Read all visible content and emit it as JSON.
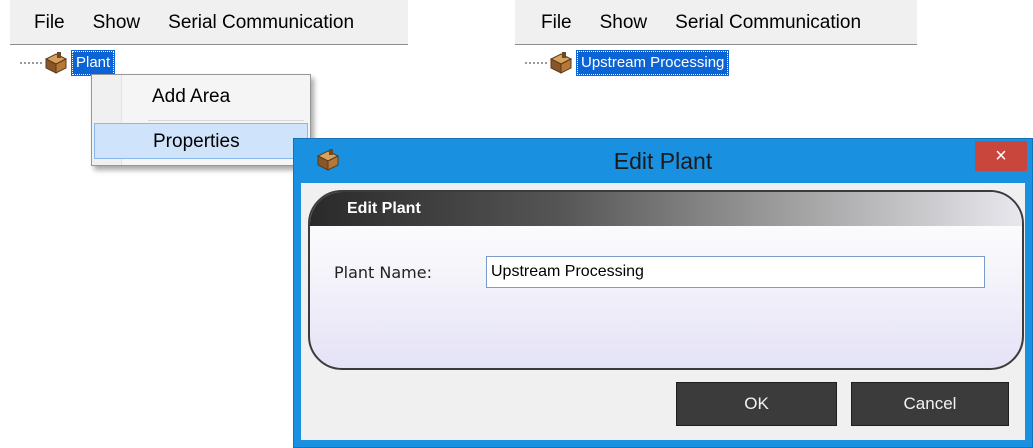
{
  "left_window": {
    "menu": [
      "File",
      "Show",
      "Serial Communication"
    ],
    "tree_node": "Plant",
    "context_menu": {
      "items": [
        "Add Area",
        "Properties"
      ],
      "highlighted": "Properties"
    }
  },
  "right_window": {
    "menu": [
      "File",
      "Show",
      "Serial Communication"
    ],
    "tree_node": "Upstream Processing"
  },
  "dialog": {
    "title": "Edit Plant",
    "close_glyph": "×",
    "group_header": "Edit Plant",
    "field_label": "Plant Name:",
    "field_value": "Upstream Processing",
    "ok_label": "OK",
    "cancel_label": "Cancel"
  },
  "colors": {
    "selection": "#0a64d6",
    "dialog_frame": "#1a90e0",
    "close_button": "#c9463d",
    "menu_highlight": "#cfe3fb",
    "button_dark": "#3b3b3b"
  },
  "icons": {
    "tree_node_icon": "plant-cube-icon",
    "dialog_title_icon": "plant-cube-icon"
  }
}
